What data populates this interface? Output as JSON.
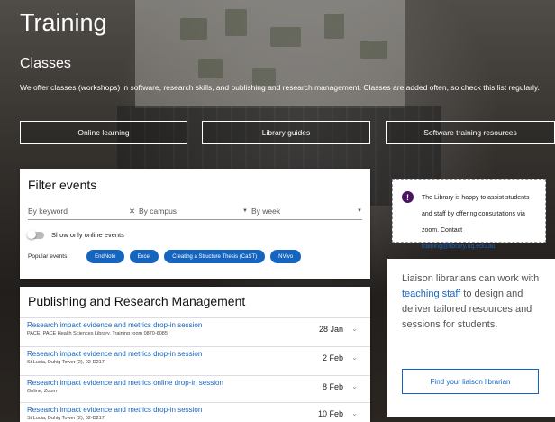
{
  "page": {
    "title": "Training",
    "subtitle": "Classes",
    "intro": "We offer classes (workshops) in software, research skills, and publishing and research management. Classes are added often, so check this list regularly."
  },
  "hero_buttons": [
    "Online learning",
    "Library guides",
    "Software training resources"
  ],
  "filter": {
    "title": "Filter events",
    "keyword_placeholder": "By keyword",
    "campus_placeholder": "By campus",
    "week_placeholder": "By week",
    "online_toggle_label": "Show only online events",
    "popular_label": "Popular events:",
    "chips": [
      "EndNote",
      "Excel",
      "Creating a Structure Thesis (CaST)",
      "NVivo"
    ]
  },
  "publishing": {
    "title": "Publishing and Research Management",
    "events": [
      {
        "title": "Research impact evidence and metrics drop-in session",
        "location": "PACE, PACE Health Sciences Library, Training room 0870-6085",
        "date": "28 Jan"
      },
      {
        "title": "Research impact evidence and metrics drop-in session",
        "location": "St Lucia, Duhig Tower (2), 02-D217",
        "date": "2 Feb"
      },
      {
        "title": "Research impact evidence and metrics online drop-in session",
        "location": "Online, Zoom",
        "date": "8 Feb"
      },
      {
        "title": "Research impact evidence and metrics drop-in session",
        "location": "St Lucia, Duhig Tower (2), 02-D217",
        "date": "10 Feb"
      }
    ]
  },
  "alert": {
    "text": "The Library is happy to assist students and staff by offering consultations via zoom. Contact",
    "email": "training@library.uq.edu.au"
  },
  "liaison": {
    "text_before": "Liaison librarians can work with",
    "link": "teaching staff",
    "text_after": "to design and deliver tailored resources and sessions for students.",
    "button": "Find your liaison librarian"
  },
  "colors": {
    "accent": "#1565c0",
    "alert_icon": "#4a1463"
  }
}
